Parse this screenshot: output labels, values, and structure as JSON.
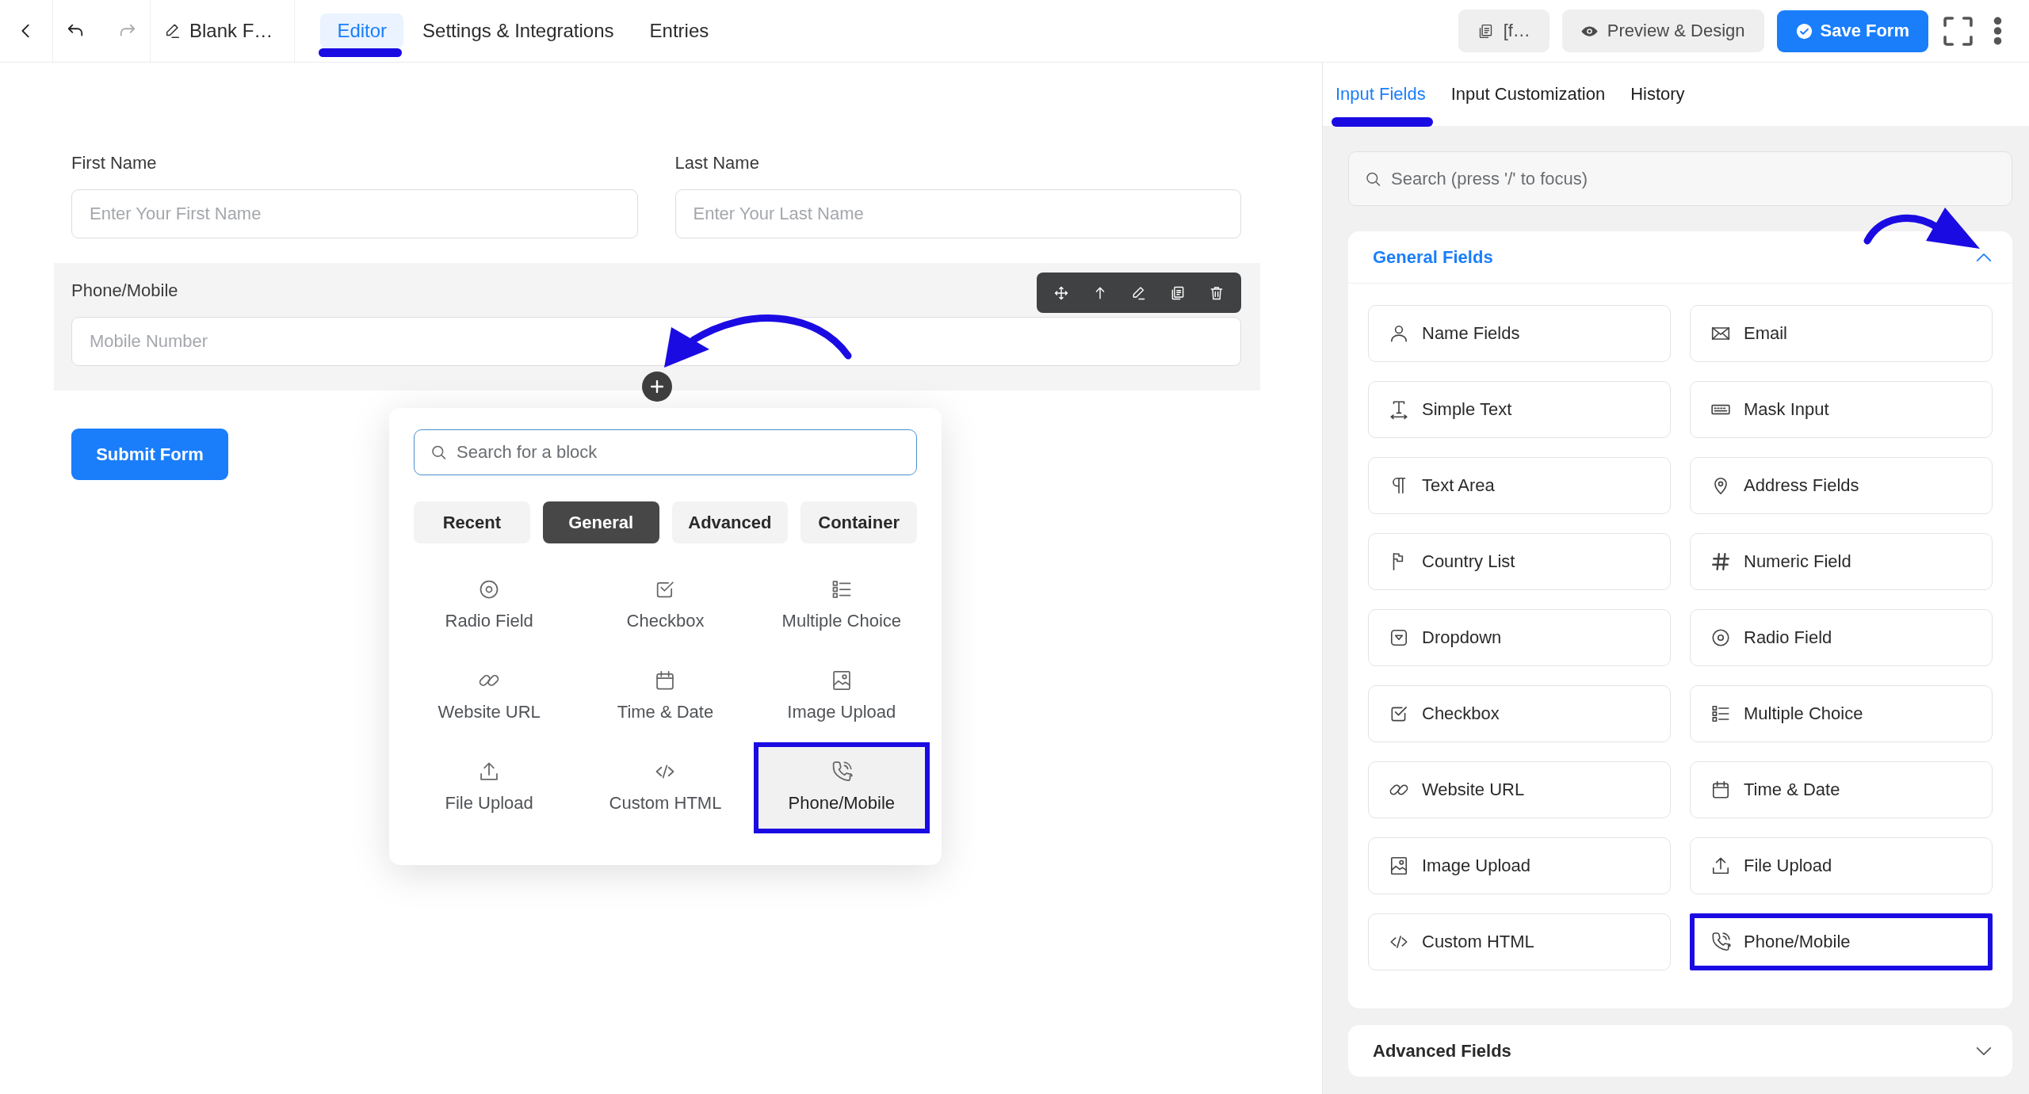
{
  "top_bar": {
    "history": {
      "undo_disabled": false,
      "redo_disabled": true
    },
    "form_title": "Blank F…",
    "tabs": [
      {
        "label": "Editor",
        "selected": true,
        "underlined": true
      },
      {
        "label": "Settings & Integrations",
        "selected": false,
        "underlined": false
      },
      {
        "label": "Entries",
        "selected": false,
        "underlined": false
      }
    ],
    "shortcode_button": "[f…",
    "preview_button": "Preview & Design",
    "save_button": "Save Form"
  },
  "form": {
    "rows": [
      {
        "selected": false,
        "pointer_arrow": false,
        "fields": [
          {
            "label": "First Name",
            "placeholder": "Enter Your First Name"
          },
          {
            "label": "Last Name",
            "placeholder": "Enter Your Last Name"
          }
        ]
      },
      {
        "selected": true,
        "pointer_arrow": true,
        "fields": [
          {
            "label": "Phone/Mobile",
            "placeholder": "Mobile Number"
          }
        ]
      }
    ],
    "submit_button": "Submit Form"
  },
  "block_inserter": {
    "search_placeholder": "Search for a block",
    "tabs": [
      {
        "label": "Recent",
        "selected": false
      },
      {
        "label": "General",
        "selected": true
      },
      {
        "label": "Advanced",
        "selected": false
      },
      {
        "label": "Container",
        "selected": false
      }
    ],
    "blocks": [
      {
        "label": "Radio Field",
        "kind": "radio",
        "outlined": false
      },
      {
        "label": "Checkbox",
        "kind": "checkbox",
        "outlined": false
      },
      {
        "label": "Multiple Choice",
        "kind": "choice",
        "outlined": false
      },
      {
        "label": "Website URL",
        "kind": "url",
        "outlined": false
      },
      {
        "label": "Time & Date",
        "kind": "date",
        "outlined": false
      },
      {
        "label": "Image Upload",
        "kind": "image",
        "outlined": false
      },
      {
        "label": "File Upload",
        "kind": "file",
        "outlined": false
      },
      {
        "label": "Custom HTML",
        "kind": "html",
        "outlined": false
      },
      {
        "label": "Phone/Mobile",
        "kind": "phone",
        "outlined": true
      }
    ]
  },
  "sidebar": {
    "tabs": [
      {
        "label": "Input Fields",
        "selected": true,
        "underlined": true
      },
      {
        "label": "Input Customization",
        "selected": false,
        "underlined": false
      },
      {
        "label": "History",
        "selected": false,
        "underlined": false
      }
    ],
    "search_placeholder": "Search (press '/' to focus)",
    "sections": [
      {
        "title": "General Fields",
        "expanded": true,
        "pointer_arrow": true,
        "items": [
          {
            "label": "Name Fields",
            "kind": "name",
            "outlined": false
          },
          {
            "label": "Email",
            "kind": "email",
            "outlined": false
          },
          {
            "label": "Simple Text",
            "kind": "text",
            "outlined": false
          },
          {
            "label": "Mask Input",
            "kind": "mask",
            "outlined": false
          },
          {
            "label": "Text Area",
            "kind": "textarea",
            "outlined": false
          },
          {
            "label": "Address Fields",
            "kind": "address",
            "outlined": false
          },
          {
            "label": "Country List",
            "kind": "country",
            "outlined": false
          },
          {
            "label": "Numeric Field",
            "kind": "number",
            "outlined": false
          },
          {
            "label": "Dropdown",
            "kind": "dropdown",
            "outlined": false
          },
          {
            "label": "Radio Field",
            "kind": "radio",
            "outlined": false
          },
          {
            "label": "Checkbox",
            "kind": "checkbox",
            "outlined": false
          },
          {
            "label": "Multiple Choice",
            "kind": "choice",
            "outlined": false
          },
          {
            "label": "Website URL",
            "kind": "url",
            "outlined": false
          },
          {
            "label": "Time & Date",
            "kind": "date",
            "outlined": false
          },
          {
            "label": "Image Upload",
            "kind": "image",
            "outlined": false
          },
          {
            "label": "File Upload",
            "kind": "file",
            "outlined": false
          },
          {
            "label": "Custom HTML",
            "kind": "html",
            "outlined": false
          },
          {
            "label": "Phone/Mobile",
            "kind": "phone",
            "outlined": true
          }
        ]
      },
      {
        "title": "Advanced Fields",
        "expanded": false,
        "pointer_arrow": false
      }
    ]
  }
}
